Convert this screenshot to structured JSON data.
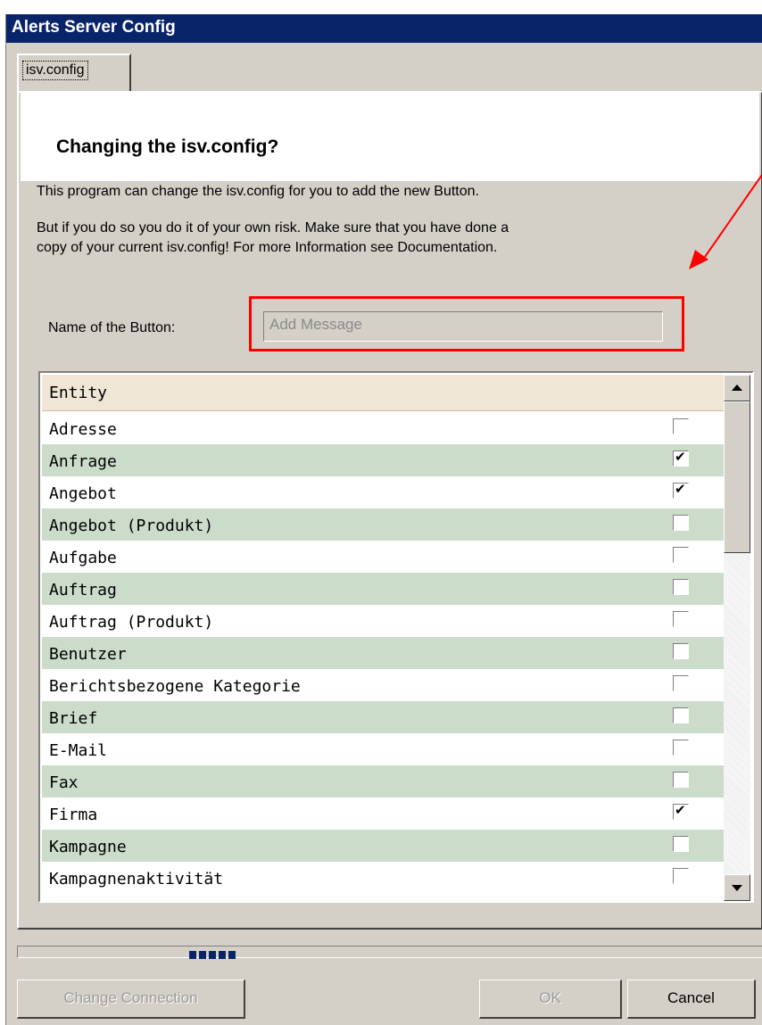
{
  "window": {
    "title": "Alerts Server Config"
  },
  "tab": {
    "label": "isv.config"
  },
  "header": {
    "title": "Changing the isv.config?"
  },
  "info": {
    "line1": "This program can change the isv.config for you to add the new Button.",
    "line2": "But if you do so you do it of your own risk. Make sure that you have done a",
    "line3": "copy of your current isv.config! For more Information see Documentation."
  },
  "button_name": {
    "label": "Name of the Button:",
    "value": "Add Message"
  },
  "entity_list": {
    "header": "Entity",
    "rows": [
      {
        "name": "Adresse",
        "checked": false
      },
      {
        "name": "Anfrage",
        "checked": true
      },
      {
        "name": "Angebot",
        "checked": true
      },
      {
        "name": "Angebot (Produkt)",
        "checked": false
      },
      {
        "name": "Aufgabe",
        "checked": false
      },
      {
        "name": "Auftrag",
        "checked": false
      },
      {
        "name": "Auftrag (Produkt)",
        "checked": false
      },
      {
        "name": "Benutzer",
        "checked": false
      },
      {
        "name": "Berichtsbezogene Kategorie",
        "checked": false
      },
      {
        "name": "Brief",
        "checked": false
      },
      {
        "name": "E-Mail",
        "checked": false
      },
      {
        "name": "Fax",
        "checked": false
      },
      {
        "name": "Firma",
        "checked": true
      },
      {
        "name": "Kampagne",
        "checked": false
      },
      {
        "name": "Kampagnenaktivität",
        "checked": false
      }
    ]
  },
  "buttons": {
    "change_connection": "Change Connection",
    "ok": "OK",
    "cancel": "Cancel"
  },
  "colors": {
    "title_bar": "#0a246a",
    "row_alt": "#cbdccb",
    "annotation": "#ff0000"
  }
}
